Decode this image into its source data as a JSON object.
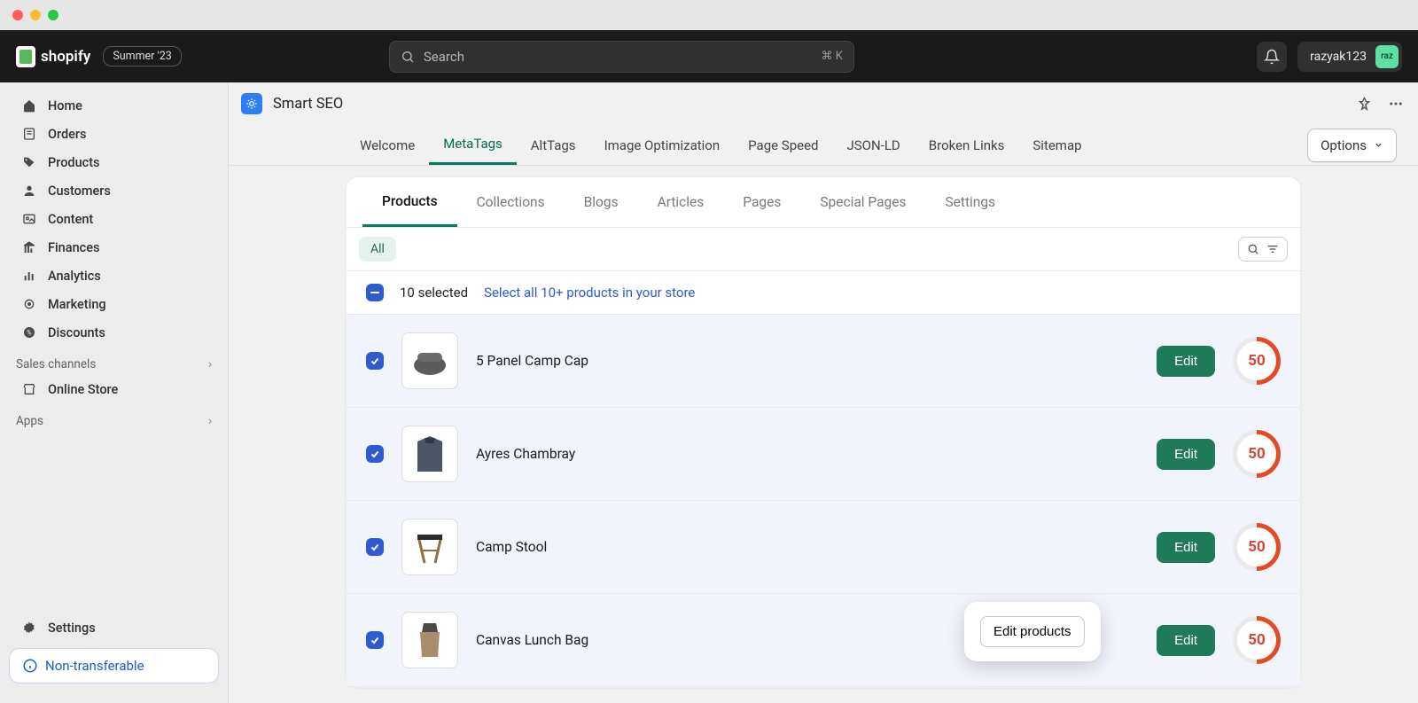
{
  "topbar": {
    "brand": "shopify",
    "summer_badge": "Summer '23",
    "search_placeholder": "Search",
    "search_shortcut": "⌘ K",
    "username": "razyak123",
    "avatar_label": "raz"
  },
  "sidebar": {
    "items": [
      {
        "label": "Home"
      },
      {
        "label": "Orders"
      },
      {
        "label": "Products"
      },
      {
        "label": "Customers"
      },
      {
        "label": "Content"
      },
      {
        "label": "Finances"
      },
      {
        "label": "Analytics"
      },
      {
        "label": "Marketing"
      },
      {
        "label": "Discounts"
      }
    ],
    "sales_channels_label": "Sales channels",
    "online_store_label": "Online Store",
    "apps_label": "Apps",
    "settings_label": "Settings",
    "nontransferable_label": "Non-transferable"
  },
  "app": {
    "title": "Smart SEO",
    "tabs": [
      "Welcome",
      "MetaTags",
      "AltTags",
      "Image Optimization",
      "Page Speed",
      "JSON-LD",
      "Broken Links",
      "Sitemap"
    ],
    "active_tab": 1,
    "options_label": "Options",
    "sub_tabs": [
      "Products",
      "Collections",
      "Blogs",
      "Articles",
      "Pages",
      "Special Pages",
      "Settings"
    ],
    "active_sub_tab": 0,
    "filter_pill": "All",
    "selection": {
      "count_text": "10 selected",
      "link_text": "Select all 10+ products in your store"
    },
    "edit_label": "Edit",
    "products": [
      {
        "name": "5 Panel Camp Cap",
        "score": 50
      },
      {
        "name": "Ayres Chambray",
        "score": 50
      },
      {
        "name": "Camp Stool",
        "score": 50
      },
      {
        "name": "Canvas Lunch Bag",
        "score": 50
      }
    ],
    "floating_label": "Edit products"
  }
}
